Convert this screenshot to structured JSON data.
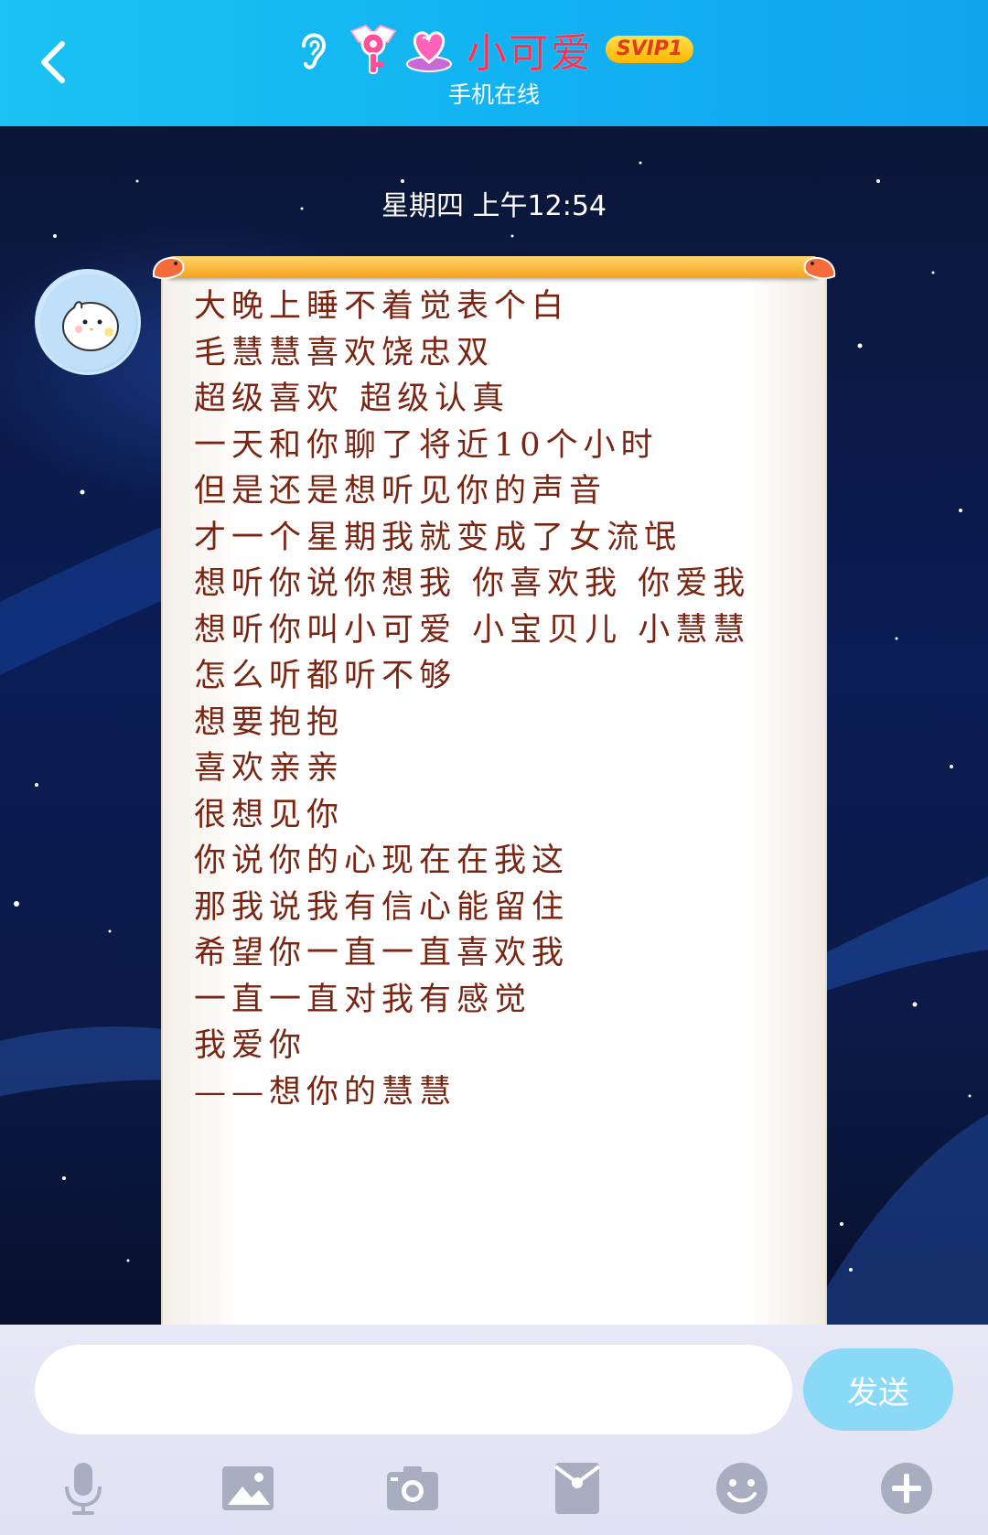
{
  "header": {
    "back_icon": "chevron-left-icon",
    "title_icons": [
      "ear-icon",
      "key-badge-icon",
      "heart-crown-icon"
    ],
    "contact_name": "小可爱",
    "badge": "SVIP1",
    "status": "手机在线",
    "bg_color": "#12b3f2",
    "name_color": "#ff2e4c"
  },
  "chat": {
    "timestamp": "星期四 上午12:54",
    "avatar_icon": "cartoon-bird-avatar",
    "letter": {
      "style": "scroll-letter",
      "text_color": "#7a2512",
      "lines": [
        "大晚上睡不着觉表个白",
        "毛慧慧喜欢饶忠双",
        "超级喜欢 超级认真",
        "一天和你聊了将近10个小时",
        "但是还是想听见你的声音",
        "才一个星期我就变成了女流氓",
        "想听你说你想我 你喜欢我 你爱我",
        "想听你叫小可爱 小宝贝儿 小慧慧",
        "怎么听都听不够",
        "想要抱抱",
        "喜欢亲亲",
        "很想见你",
        "你说你的心现在在我这",
        "那我说我有信心能留住",
        "希望你一直一直喜欢我",
        "一直一直对我有感觉",
        "我爱你",
        "——想你的慧慧"
      ]
    }
  },
  "input_bar": {
    "input_value": "",
    "input_placeholder": "",
    "send_label": "发送",
    "send_color": "#8ad9f7",
    "tools": [
      "microphone-icon",
      "image-icon",
      "camera-icon",
      "red-envelope-icon",
      "emoji-icon",
      "plus-icon"
    ]
  }
}
